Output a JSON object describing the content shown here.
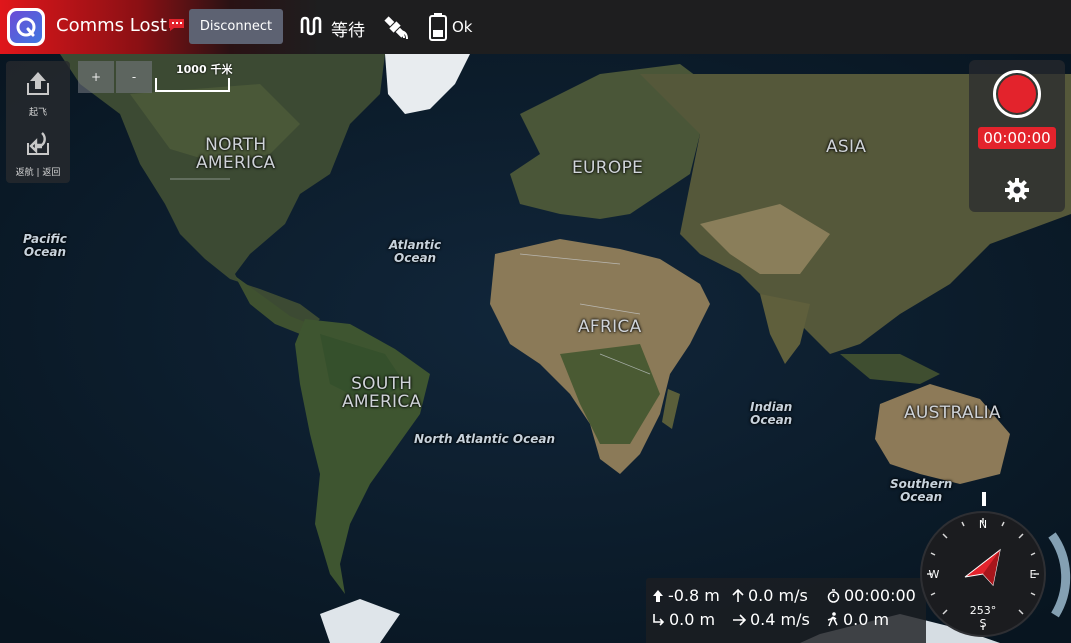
{
  "toolbar": {
    "comms_status": "Comms Lost",
    "disconnect_label": "Disconnect",
    "flight_mode": "等待",
    "battery_status": "Ok",
    "icons": [
      "app-logo-icon",
      "message-icon",
      "flight-mode-icon",
      "gps-satellite-icon",
      "battery-icon"
    ]
  },
  "tools": [
    {
      "label": "起飞",
      "icon": "takeoff-icon"
    },
    {
      "label": "返航 | 返回",
      "icon": "return-icon"
    }
  ],
  "map": {
    "zoom_in": "+",
    "zoom_out": "-",
    "scale": "1000 千米",
    "continents": {
      "north_america": [
        "NORTH",
        "AMERICA"
      ],
      "south_america": [
        "SOUTH",
        "AMERICA"
      ],
      "europe": "EUROPE",
      "asia": "ASIA",
      "africa": "AFRICA",
      "australia": "AUSTRALIA"
    },
    "oceans": {
      "pacific": [
        "Pacific",
        "Ocean"
      ],
      "atlantic": [
        "Atlantic",
        "Ocean"
      ],
      "north_atlantic": "North Atlantic Ocean",
      "indian": [
        "Indian",
        "Ocean"
      ],
      "southern": [
        "Southern",
        "Ocean"
      ]
    }
  },
  "record": {
    "time": "00:00:00",
    "color": "#e3232c"
  },
  "telemetry": {
    "altitude": "-0.8 m",
    "vertical_speed": "0.0 m/s",
    "flight_time": "00:00:00",
    "distance_home": "0.0 m",
    "ground_speed": "0.4 m/s",
    "distance": "0.0 m"
  },
  "compass": {
    "north": "N",
    "south": "S",
    "east": "E",
    "west": "W",
    "heading": "253°"
  },
  "colors": {
    "accent_red": "#e3232c",
    "toolbar_bg": "#1e1e1f",
    "button_bg": "#5d6272"
  }
}
